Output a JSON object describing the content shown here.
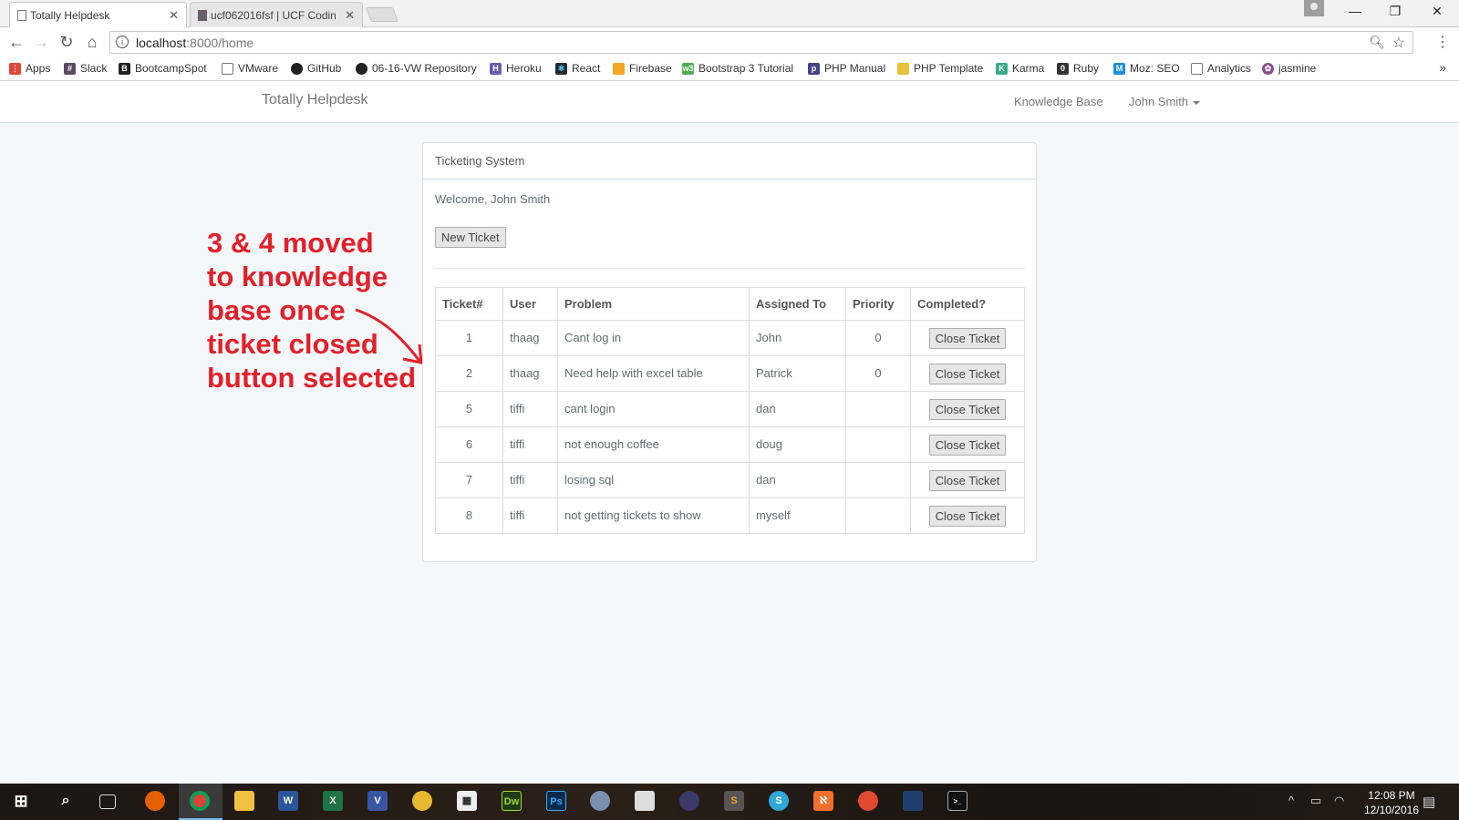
{
  "browser": {
    "tabs": [
      {
        "title": "Totally Helpdesk",
        "active": true
      },
      {
        "title": "ucf062016fsf | UCF Codin",
        "active": false
      }
    ],
    "address": {
      "host": "localhost",
      "path": ":8000/home"
    },
    "bookmarks": [
      {
        "label": "Apps",
        "icon": "apps-grid-icon",
        "color": "#e0463a"
      },
      {
        "label": "Slack",
        "icon": "hash-icon",
        "color": "#5a4a5e"
      },
      {
        "label": "BootcampSpot",
        "icon": "b-icon",
        "color": "#222222"
      },
      {
        "label": "VMware",
        "icon": "page-icon",
        "color": "#ffffff"
      },
      {
        "label": "GitHub",
        "icon": "github-icon",
        "color": "#222222"
      },
      {
        "label": "06-16-VW Repository",
        "icon": "github-icon",
        "color": "#222222"
      },
      {
        "label": "Heroku",
        "icon": "heroku-icon",
        "color": "#6b5aad"
      },
      {
        "label": "React",
        "icon": "react-icon",
        "color": "#222b38"
      },
      {
        "label": "Firebase",
        "icon": "firebase-icon",
        "color": "#f5a623"
      },
      {
        "label": "Bootstrap 3 Tutorial",
        "icon": "w3-icon",
        "color": "#4caf50"
      },
      {
        "label": "PHP Manual",
        "icon": "php-icon",
        "color": "#444488"
      },
      {
        "label": "PHP Template",
        "icon": "bulb-icon",
        "color": "#e8c03a"
      },
      {
        "label": "Karma",
        "icon": "karma-icon",
        "color": "#3aa88a"
      },
      {
        "label": "Ruby",
        "icon": "ruby-icon",
        "color": "#333333"
      },
      {
        "label": "Moz: SEO",
        "icon": "moz-icon",
        "color": "#1d8fe0"
      },
      {
        "label": "Analytics",
        "icon": "page-icon",
        "color": "#ffffff"
      },
      {
        "label": "jasmine",
        "icon": "jasmine-icon",
        "color": "#8a4d8f"
      }
    ]
  },
  "app": {
    "brand": "Totally Helpdesk",
    "nav": {
      "knowledge_base": "Knowledge Base",
      "user": "John Smith"
    }
  },
  "panel": {
    "heading": "Ticketing System",
    "welcome": "Welcome, John Smith",
    "new_ticket_label": "New Ticket",
    "columns": [
      "Ticket#",
      "User",
      "Problem",
      "Assigned To",
      "Priority",
      "Completed?"
    ],
    "close_label": "Close Ticket",
    "rows": [
      {
        "id": "1",
        "user": "thaag",
        "problem": "Cant log in",
        "assigned": "John",
        "priority": "0"
      },
      {
        "id": "2",
        "user": "thaag",
        "problem": "Need help with excel table",
        "assigned": "Patrick",
        "priority": "0"
      },
      {
        "id": "5",
        "user": "tiffi",
        "problem": "cant login",
        "assigned": "dan",
        "priority": ""
      },
      {
        "id": "6",
        "user": "tiffi",
        "problem": "not enough coffee",
        "assigned": "doug",
        "priority": ""
      },
      {
        "id": "7",
        "user": "tiffi",
        "problem": "losing sql",
        "assigned": "dan",
        "priority": ""
      },
      {
        "id": "8",
        "user": "tiffi",
        "problem": "not getting tickets to show",
        "assigned": "myself",
        "priority": ""
      }
    ]
  },
  "annotation": {
    "lines": [
      "3 & 4 moved",
      "to knowledge",
      "base once",
      "ticket closed",
      "button selected"
    ],
    "color": "#e3202a"
  },
  "taskbar": {
    "time": "12:08 PM",
    "date": "12/10/2016"
  }
}
